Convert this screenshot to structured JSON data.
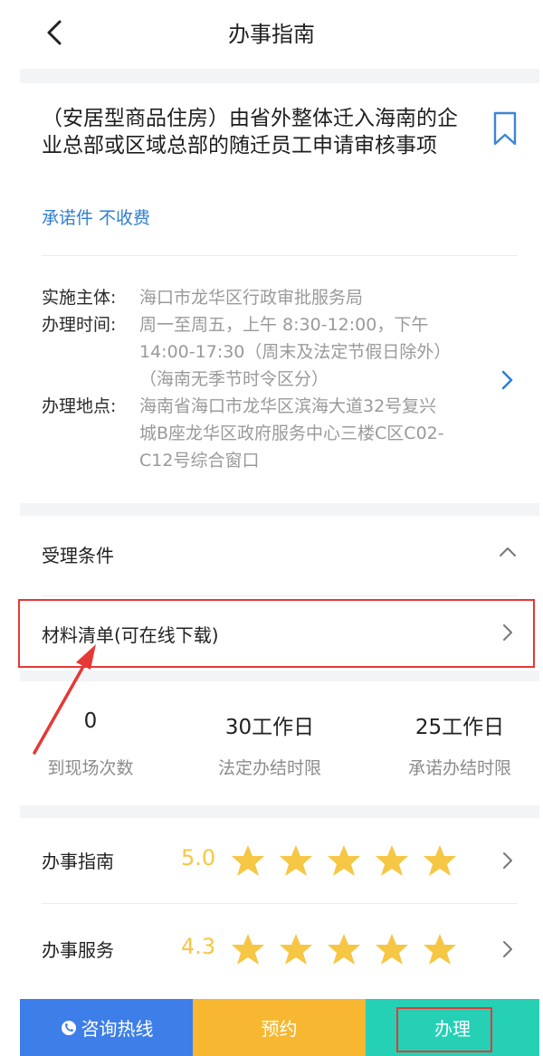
{
  "header": {
    "title": "办事指南"
  },
  "item": {
    "title": "（安居型商品住房）由省外整体迁入海南的企业总部或区域总部的随迁员工申请审核事项",
    "tags": "承诺件 不收费"
  },
  "info": {
    "implementer_label": "实施主体:",
    "implementer_value": "海口市龙华区行政审批服务局",
    "hours_label": "办理时间:",
    "hours_value": "周一至周五，上午 8:30-12:00，下午14:00-17:30（周末及法定节假日除外）（海南无季节时令区分）",
    "location_label": "办理地点:",
    "location_value": "海南省海口市龙华区滨海大道32号复兴城B座龙华区政府服务中心三楼C区C02-C12号综合窗口"
  },
  "sections": {
    "conditions": "受理条件",
    "materials": "材料清单(可在线下载)"
  },
  "stats": [
    {
      "value": "0",
      "label": "到现场次数"
    },
    {
      "value": "30工作日",
      "label": "法定办结时限"
    },
    {
      "value": "25工作日",
      "label": "承诺办结时限"
    }
  ],
  "ratings": [
    {
      "label": "办事指南",
      "score": "5.0",
      "stars": 5
    },
    {
      "label": "办事服务",
      "score": "4.3",
      "stars": 5
    }
  ],
  "bottom": {
    "hotline": "咨询热线",
    "appointment": "预约",
    "handle": "办理"
  },
  "colors": {
    "accent_blue": "#2f7fd2",
    "star": "#f6c744",
    "hotline_bg": "#3d7ee8",
    "appointment_bg": "#f7b731",
    "handle_bg": "#25d0b5",
    "annotation_red": "#e53935"
  }
}
